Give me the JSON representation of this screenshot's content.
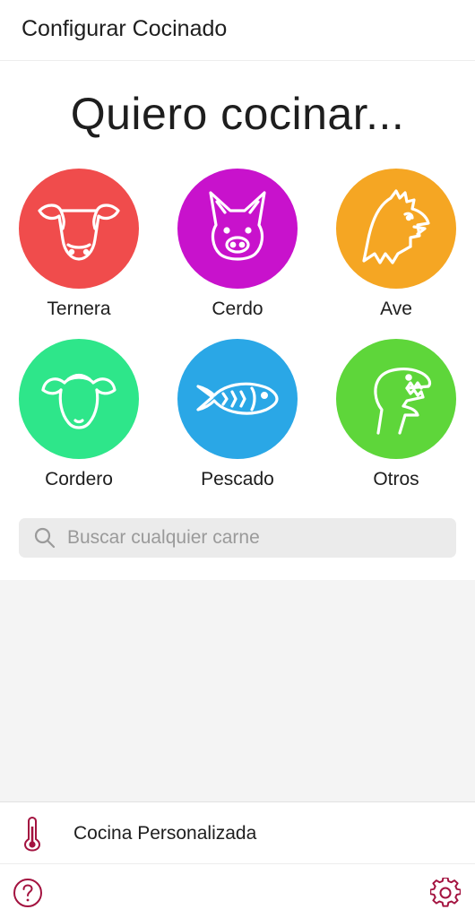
{
  "header": {
    "title": "Configurar Cocinado"
  },
  "hero": {
    "title": "Quiero cocinar..."
  },
  "categories": [
    {
      "label": "Ternera",
      "icon": "cow-icon",
      "color": "#f04c4c"
    },
    {
      "label": "Cerdo",
      "icon": "pig-icon",
      "color": "#c812cc"
    },
    {
      "label": "Ave",
      "icon": "rooster-icon",
      "color": "#f5a623"
    },
    {
      "label": "Cordero",
      "icon": "sheep-icon",
      "color": "#2ee68a"
    },
    {
      "label": "Pescado",
      "icon": "fish-icon",
      "color": "#2aa7e6"
    },
    {
      "label": "Otros",
      "icon": "dinosaur-icon",
      "color": "#5ed63a"
    }
  ],
  "search": {
    "placeholder": "Buscar cualquier carne",
    "value": ""
  },
  "custom_cooking": {
    "label": "Cocina Personalizada",
    "icon": "thermometer-icon"
  },
  "footer": {
    "help_icon": "help-icon",
    "settings_icon": "settings-icon"
  },
  "colors": {
    "accent": "#a3123f",
    "text": "#1e1e1e",
    "search_bg": "#ebebeb"
  }
}
